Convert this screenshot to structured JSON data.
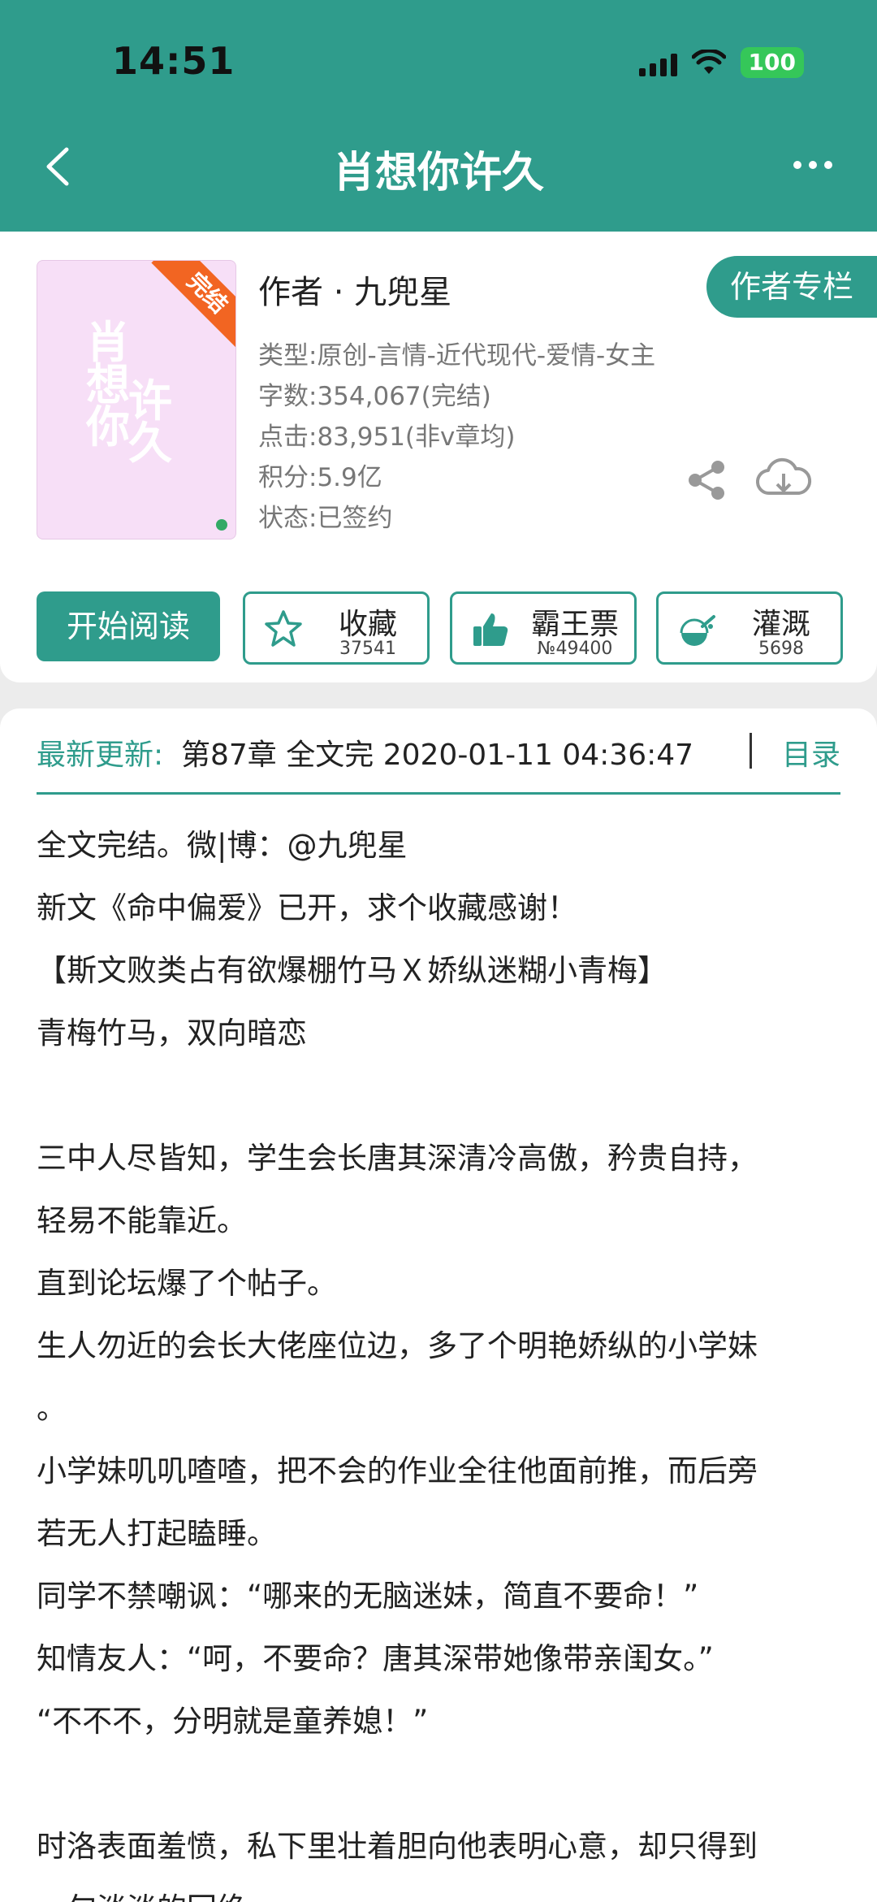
{
  "status_bar": {
    "time": "14:51",
    "battery": "100"
  },
  "nav": {
    "title": "肖想你许久"
  },
  "book": {
    "cover_title_col1": "肖想你",
    "cover_title_col2": "许久",
    "cover_badge": "完结",
    "author_line": "作者 · 九兜星",
    "author_column_label": "作者专栏",
    "meta": {
      "type": "类型:原创-言情-近代现代-爱情-女主",
      "words": "字数:354,067(完结)",
      "clicks": "点击:83,951(非v章均)",
      "score": "积分:5.9亿",
      "status": "状态:已签约"
    }
  },
  "actions": {
    "read_label": "开始阅读",
    "favorite": {
      "label": "收藏",
      "count": "37541"
    },
    "vote": {
      "label": "霸王票",
      "count": "№49400"
    },
    "water": {
      "label": "灌溉",
      "count": "5698"
    }
  },
  "update": {
    "label": "最新更新:",
    "text": "第87章 全文完 2020-01-11 04:36:47",
    "toc_label": "目录"
  },
  "intro_lines": [
    "全文完结。微|博：@九兜星",
    "新文《命中偏爱》已开，求个收藏感谢！",
    "【斯文败类占有欲爆棚竹马Ｘ娇纵迷糊小青梅】",
    "青梅竹马，双向暗恋",
    "",
    "三中人尽皆知，学生会长唐其深清冷高傲，矜贵自持，",
    "轻易不能靠近。",
    "直到论坛爆了个帖子。",
    "生人勿近的会长大佬座位边，多了个明艳娇纵的小学妹",
    "。",
    "小学妹叽叽喳喳，把不会的作业全往他面前推，而后旁",
    "若无人打起瞌睡。",
    "同学不禁嘲讽：“哪来的无脑迷妹，简直不要命！”",
    "知情友人：“呵，不要命？唐其深带她像带亲闺女。”",
    "“不不不，分明就是童养媳！”",
    "",
    "时洛表面羞愤，私下里壮着胆向他表明心意，却只得到",
    "一句淡淡的回绝。"
  ]
}
